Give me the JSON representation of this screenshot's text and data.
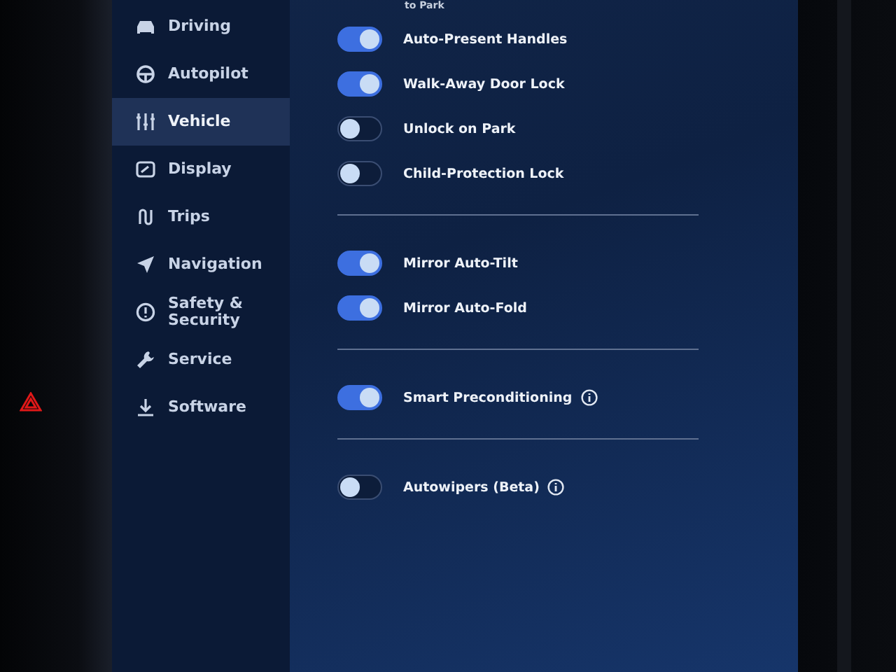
{
  "sidebar": {
    "items": [
      {
        "label": "Driving",
        "selected": false
      },
      {
        "label": "Autopilot",
        "selected": false
      },
      {
        "label": "Vehicle",
        "selected": true
      },
      {
        "label": "Display",
        "selected": false
      },
      {
        "label": "Trips",
        "selected": false
      },
      {
        "label": "Navigation",
        "selected": false
      },
      {
        "label": "Safety & Security",
        "selected": false
      },
      {
        "label": "Service",
        "selected": false
      },
      {
        "label": "Software",
        "selected": false
      }
    ]
  },
  "settings": {
    "cut_label": "to Park",
    "groups": [
      [
        {
          "label": "Auto-Present Handles",
          "on": true,
          "info": false
        },
        {
          "label": "Walk-Away Door Lock",
          "on": true,
          "info": false
        },
        {
          "label": "Unlock on Park",
          "on": false,
          "info": false
        },
        {
          "label": "Child-Protection Lock",
          "on": false,
          "info": false
        }
      ],
      [
        {
          "label": "Mirror Auto-Tilt",
          "on": true,
          "info": false
        },
        {
          "label": "Mirror Auto-Fold",
          "on": true,
          "info": false
        }
      ],
      [
        {
          "label": "Smart Preconditioning",
          "on": true,
          "info": true
        }
      ],
      [
        {
          "label": "Autowipers (Beta)",
          "on": false,
          "info": true
        }
      ]
    ]
  }
}
